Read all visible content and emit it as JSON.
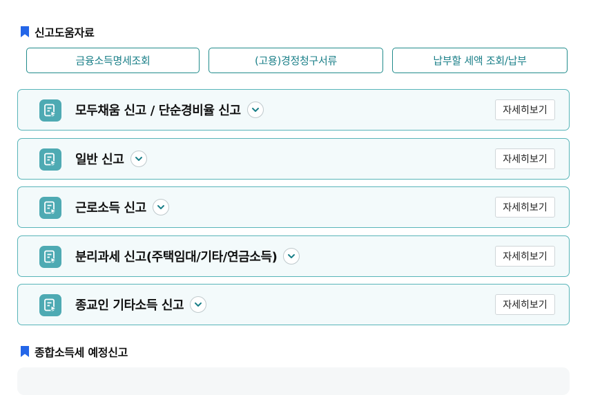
{
  "help_section": {
    "title": "신고도움자료",
    "links": [
      {
        "label": "금융소득명세조회"
      },
      {
        "label": "(고용)경정청구서류"
      },
      {
        "label": "납부할 세액 조회/납부"
      }
    ]
  },
  "report_types": [
    {
      "title": "모두채움 신고 / 단순경비율 신고",
      "detail_label": "자세히보기"
    },
    {
      "title": "일반 신고",
      "detail_label": "자세히보기"
    },
    {
      "title": "근로소득 신고",
      "detail_label": "자세히보기"
    },
    {
      "title": "분리과세 신고(주택임대/기타/연금소득)",
      "detail_label": "자세히보기"
    },
    {
      "title": "종교인 기타소득 신고",
      "detail_label": "자세히보기"
    }
  ],
  "next_section": {
    "title": "종합소득세 예정신고"
  },
  "colors": {
    "accent": "#1f8a8a",
    "icon_bg": "#4eaab3",
    "bookmark": "#2466e8",
    "card_bg": "#f3fafb"
  },
  "icons": {
    "bookmark": "bookmark-icon",
    "document": "document-play-icon",
    "chevron": "chevron-down-icon"
  }
}
